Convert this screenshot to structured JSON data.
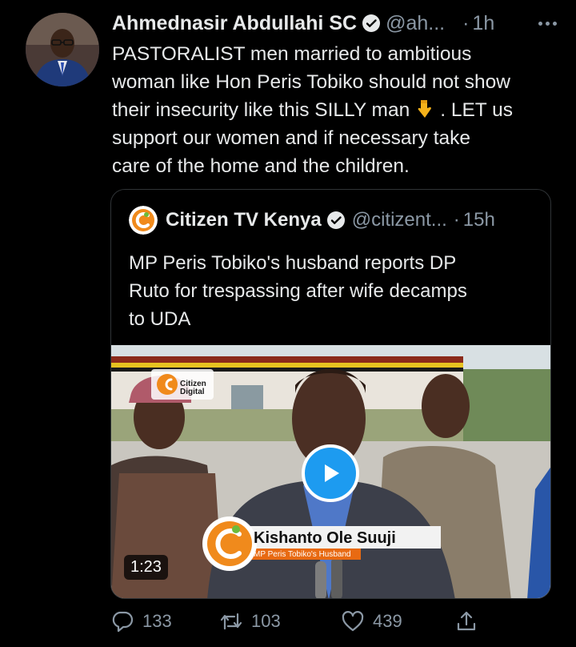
{
  "author": {
    "name": "Ahmednasir Abdullahi SC",
    "handle": "@ah...",
    "time": "1h",
    "separator": "·"
  },
  "tweet": {
    "lines": [
      "PASTORALIST men married to ambitious",
      "woman like Hon Peris Tobiko should not show",
      "their insecurity like this SILLY man",
      ". LET us",
      "support our women and if necessary take",
      "care of the home and the children."
    ],
    "emoji": "pointing-down-hand-icon"
  },
  "quoted": {
    "name": "Citizen TV Kenya",
    "handle": "@citizent...",
    "time": "15h",
    "separator": "·",
    "lines": [
      "MP Peris Tobiko's husband reports DP",
      "Ruto for trespassing after wife decamps",
      "to UDA"
    ],
    "video": {
      "duration": "1:23",
      "lower_third_name": "Kishanto Ole Suuji",
      "lower_third_role": "MP Peris Tobiko's Husband",
      "watermark": "Citizen\nDigital"
    }
  },
  "actions": {
    "replies": "133",
    "retweets": "103",
    "likes": "439"
  },
  "colors": {
    "background": "#000000",
    "text": "#e7e9ea",
    "muted": "#8b98a5",
    "accent": "#1d9bf0",
    "border": "#2f3336"
  }
}
